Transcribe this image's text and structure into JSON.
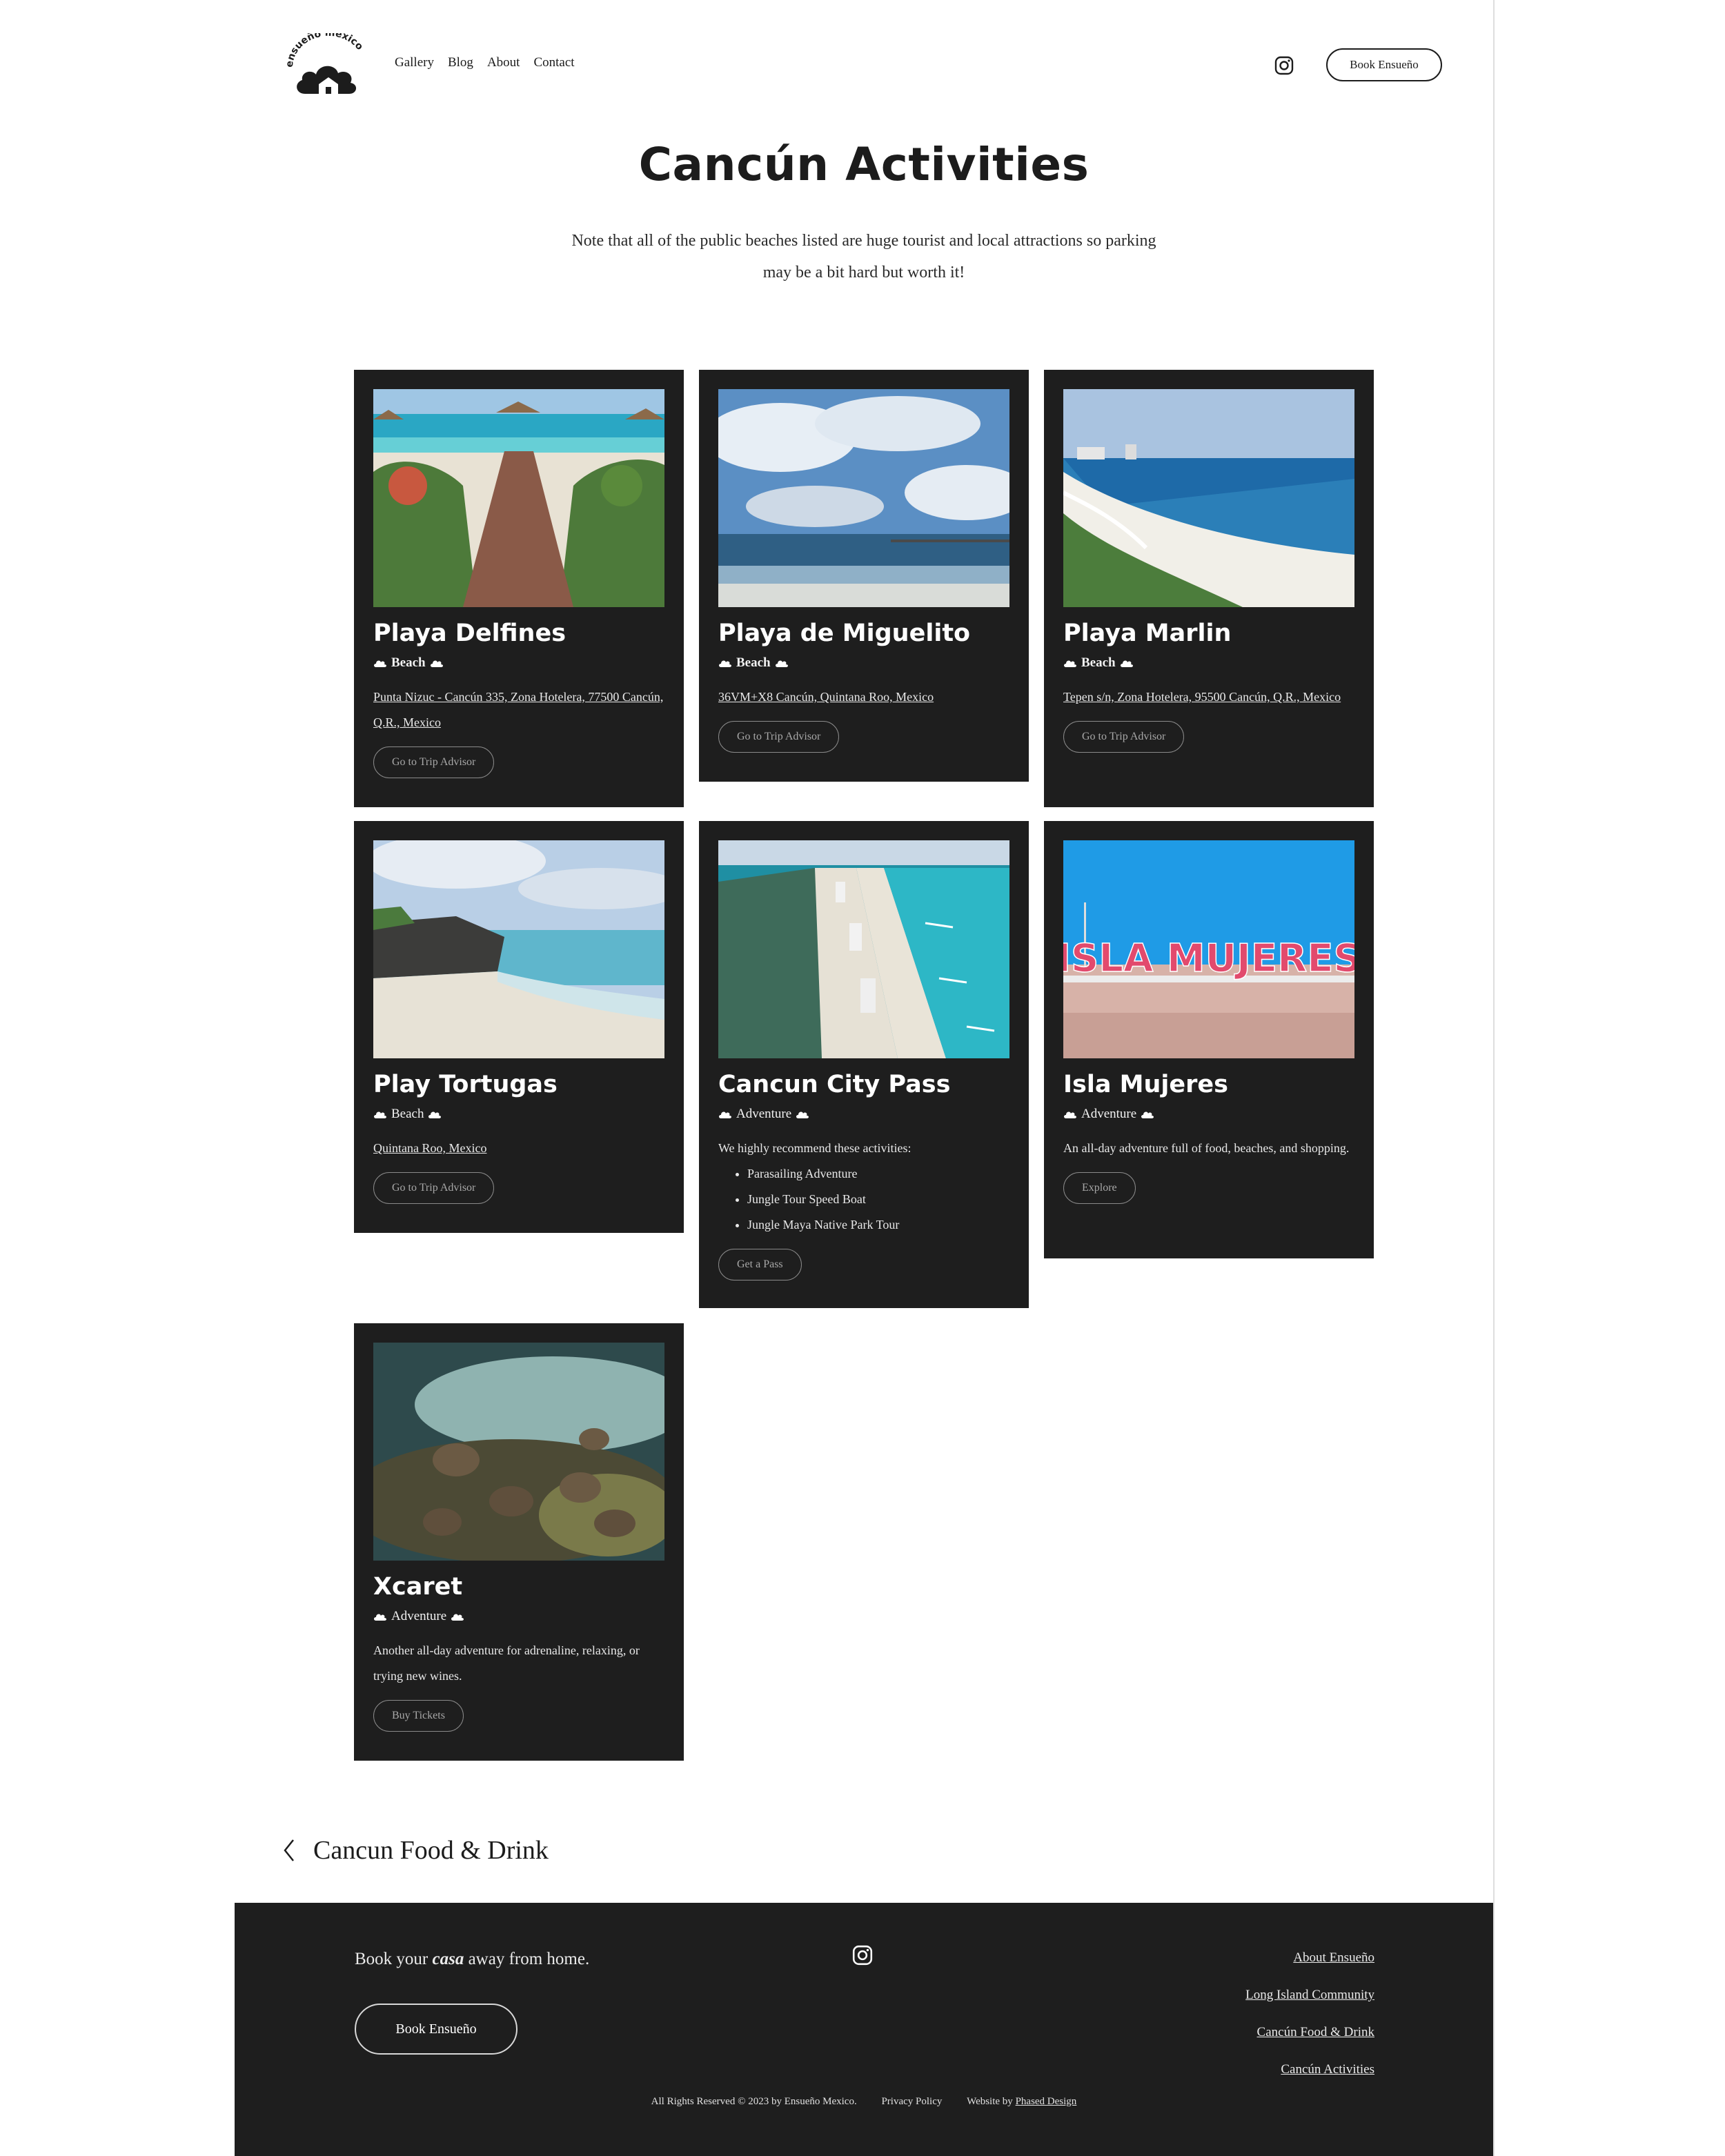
{
  "header": {
    "logo_text": "ensueño mexico",
    "nav": [
      "Gallery",
      "Blog",
      "About",
      "Contact"
    ],
    "book_button": "Book Ensueño"
  },
  "page": {
    "title": "Cancún Activities",
    "intro": "Note that all of the public beaches listed are huge tourist and local attractions so parking may be a bit hard but worth it!"
  },
  "cards": [
    {
      "name": "Playa Delfines",
      "tag": "Beach",
      "address": "Punta Nizuc - Cancún 335, Zona Hotelera, 77500 Cancún, Q.R., Mexico",
      "button": "Go to Trip Advisor"
    },
    {
      "name": "Playa de Miguelito",
      "tag": "Beach",
      "address": "36VM+X8 Cancún, Quintana Roo, Mexico",
      "button": "Go to Trip Advisor"
    },
    {
      "name": "Playa Marlin",
      "tag": "Beach",
      "address": "Tepen s/n, Zona Hotelera, 95500 Cancún, Q.R., Mexico",
      "button": "Go to Trip Advisor"
    },
    {
      "name": "Play Tortugas",
      "tag": "Beach",
      "address": "Quintana Roo, Mexico",
      "button": "Go to Trip Advisor"
    },
    {
      "name": "Cancun City Pass",
      "tag": "Adventure",
      "description": "We highly recommend these activities:",
      "list": [
        "Parasailing Adventure",
        "Jungle Tour Speed Boat",
        "Jungle Maya Native Park Tour"
      ],
      "button": "Get a Pass"
    },
    {
      "name": "Isla Mujeres",
      "tag": "Adventure",
      "sign_text": "ISLA MUJERES",
      "description": "An all-day adventure full of food, beaches, and shopping.",
      "button": "Explore"
    },
    {
      "name": "Xcaret",
      "tag": "Adventure",
      "description": "Another all-day adventure for adrenaline, relaxing, or trying new wines.",
      "button": "Buy Tickets"
    }
  ],
  "prev_link": "Cancun Food & Drink",
  "footer": {
    "tagline_before": "Book your",
    "tagline_em": "casa",
    "tagline_after": "away from home.",
    "book_button": "Book Ensueño",
    "links": [
      "About Ensueño",
      "Long Island Community",
      "Cancún Food & Drink",
      "Cancún Activities"
    ],
    "rights": "All Rights Reserved © 2023 by Ensueño Mexico.",
    "privacy": "Privacy Policy",
    "website_by": "Website by",
    "designer": "Phased Design"
  },
  "colors": {
    "dark": "#1e1e1e",
    "text": "#1c1c1c",
    "button_border": "#8a8a8a"
  }
}
